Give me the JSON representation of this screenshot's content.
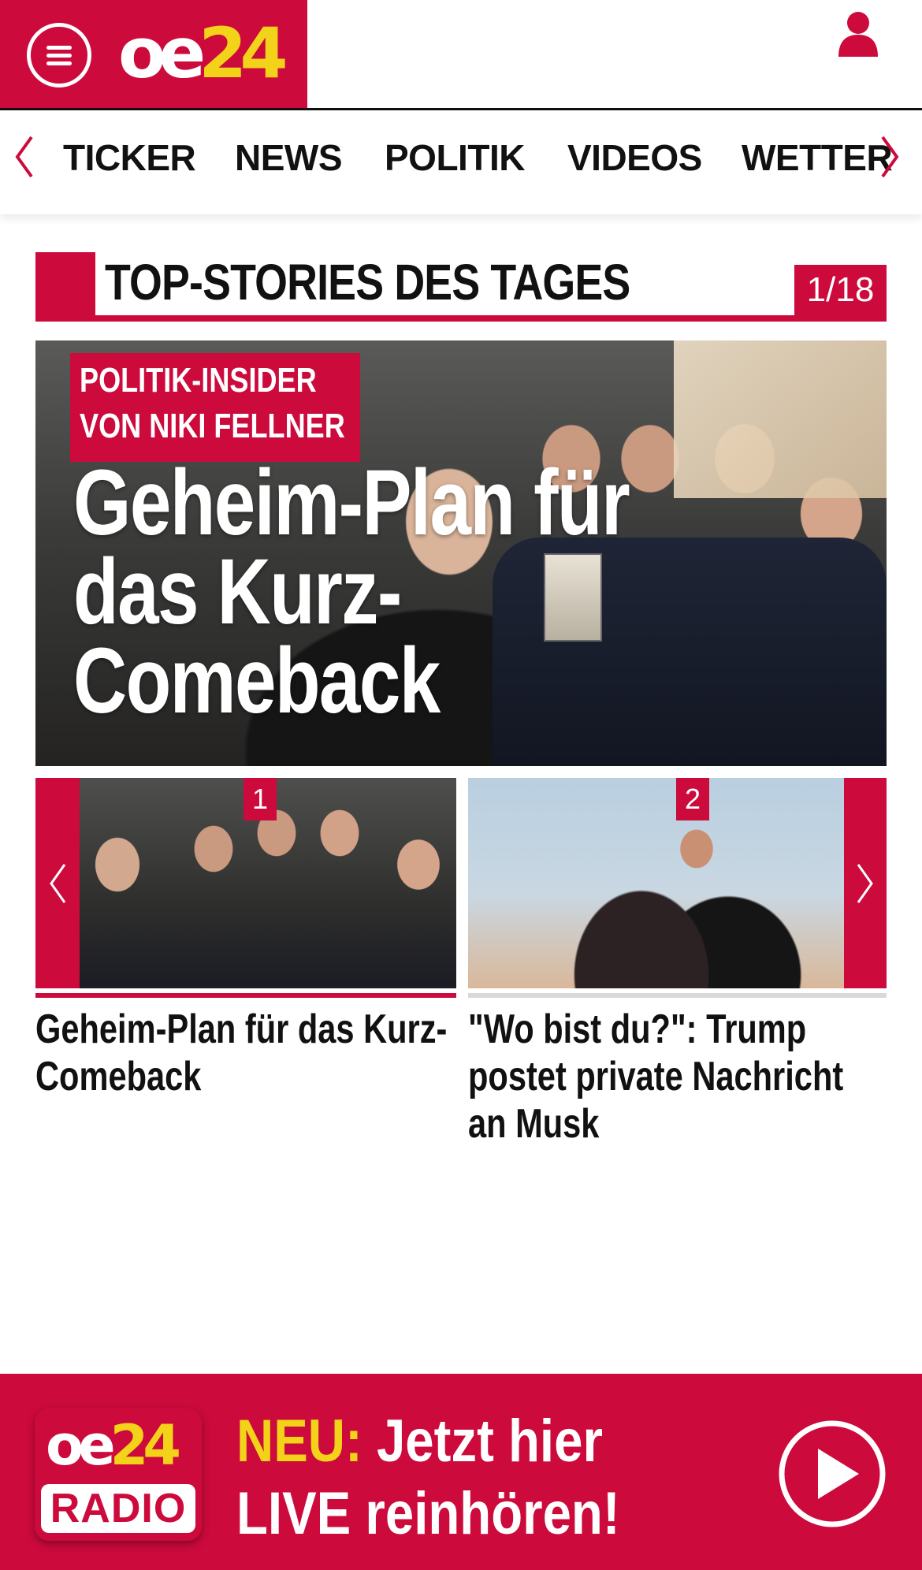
{
  "brand": {
    "logo_letters": "oe",
    "logo_number": "24",
    "accent": "#cc0a3c",
    "yellow": "#f3d319"
  },
  "header": {
    "menu_icon": "hamburger-icon",
    "user_icon": "user-icon"
  },
  "nav": {
    "items": [
      "TICKER",
      "NEWS",
      "POLITIK",
      "VIDEOS",
      "WETTER"
    ]
  },
  "section": {
    "title": "TOP-STORIES DES TAGES",
    "counter": "1/18"
  },
  "hero": {
    "badge_line1": "POLITIK-INSIDER",
    "badge_line2": "VON NIKI FELLNER",
    "title": "Geheim-Plan für das Kurz-Comeback"
  },
  "carousel": {
    "cards": [
      {
        "number": "1",
        "title": "Geheim-Plan für das Kurz-Comeback"
      },
      {
        "number": "2",
        "title": "\"Wo bist du?\": Trump postet private Nachricht an Musk"
      }
    ]
  },
  "radio": {
    "logo_letters": "oe",
    "logo_number": "24",
    "logo_label": "RADIO",
    "neu": "NEU:",
    "line1": "Jetzt hier",
    "line2": "LIVE reinhören!"
  }
}
